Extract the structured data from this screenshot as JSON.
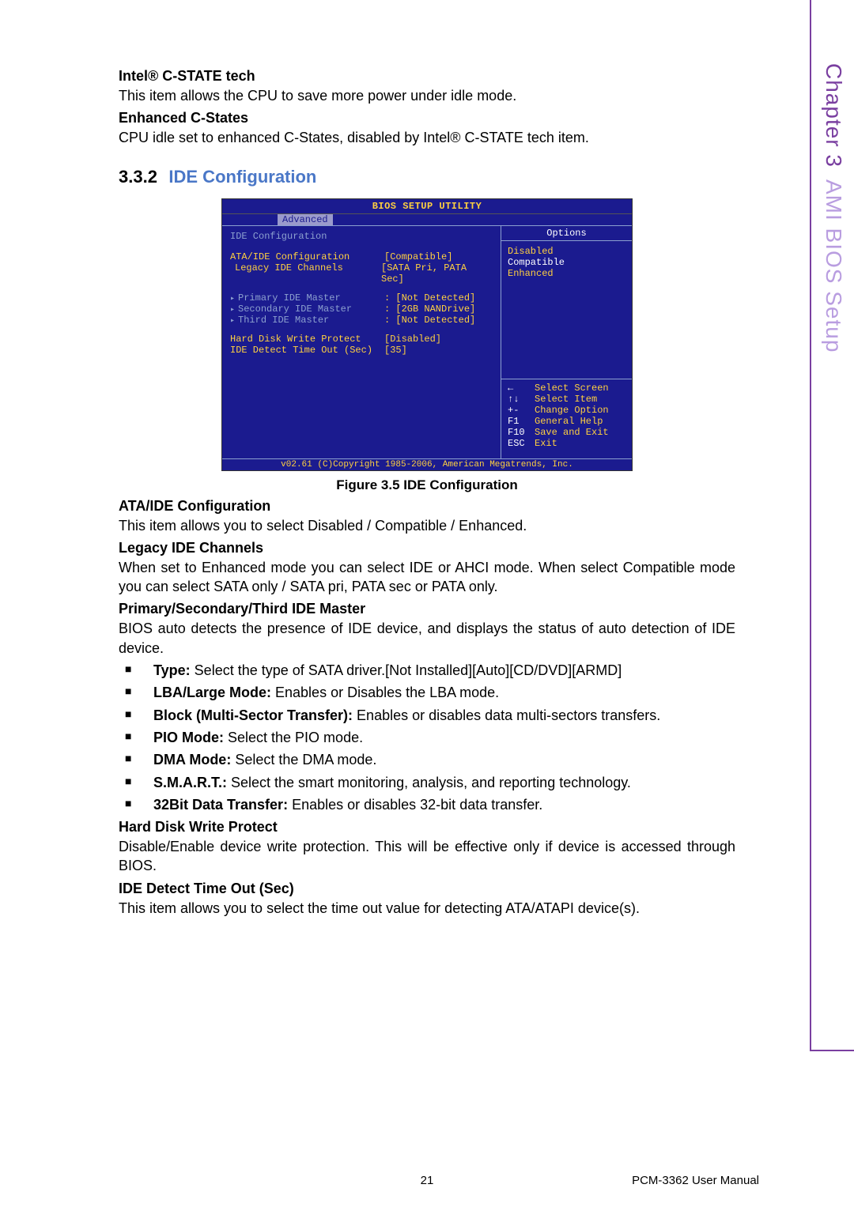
{
  "side": {
    "chapter": "Chapter 3",
    "section": "AMI BIOS Setup"
  },
  "intro": {
    "h1": "Intel® C-STATE tech",
    "p1": "This item allows the CPU to save more power under idle mode.",
    "h2": "Enhanced C-States",
    "p2": "CPU idle set to enhanced C-States, disabled by Intel® C-STATE tech item."
  },
  "section": {
    "num": "3.3.2",
    "title": "IDE Configuration"
  },
  "bios": {
    "title": "BIOS SETUP UTILITY",
    "tab": "Advanced",
    "header": "IDE Configuration",
    "rows": [
      {
        "label": "ATA/IDE Configuration",
        "value": "[Compatible]",
        "opt": true
      },
      {
        "label": "Legacy IDE Channels",
        "value": "[SATA Pri, PATA Sec]",
        "opt": true,
        "indent": true
      }
    ],
    "masters": [
      {
        "label": "Primary IDE Master",
        "value": ": [Not Detected]"
      },
      {
        "label": "Secondary IDE Master",
        "value": ": [2GB NANDrive]"
      },
      {
        "label": "Third IDE Master",
        "value": ": [Not Detected]"
      }
    ],
    "extra": [
      {
        "label": "Hard Disk Write Protect",
        "value": "[Disabled]"
      },
      {
        "label": "IDE Detect Time Out (Sec)",
        "value": "[35]"
      }
    ],
    "options_header": "Options",
    "options": [
      "Disabled",
      "Compatible",
      "Enhanced"
    ],
    "selected_option": "Compatible",
    "nav": [
      {
        "key": "←",
        "text": "Select Screen"
      },
      {
        "key": "↑↓",
        "text": "Select Item"
      },
      {
        "key": "+-",
        "text": "Change Option"
      },
      {
        "key": "F1",
        "text": "General Help"
      },
      {
        "key": "F10",
        "text": "Save and Exit"
      },
      {
        "key": "ESC",
        "text": "Exit"
      }
    ],
    "copyright": "v02.61 (C)Copyright 1985-2006, American Megatrends, Inc."
  },
  "caption": "Figure 3.5 IDE Configuration",
  "below": {
    "h1": "ATA/IDE Configuration",
    "p1": "This item allows you to select Disabled / Compatible / Enhanced.",
    "h2": "Legacy IDE Channels",
    "p2": "When set to Enhanced mode you can select IDE or AHCI mode. When select Compatible mode you can select SATA only / SATA pri, PATA sec or PATA only.",
    "h3": "Primary/Secondary/Third IDE Master",
    "p3": "BIOS auto detects the presence of IDE device, and displays the status of auto detection of IDE device.",
    "bullets": [
      {
        "b": "Type:",
        "t": " Select the type of SATA driver.[Not Installed][Auto][CD/DVD][ARMD]"
      },
      {
        "b": "LBA/Large Mode:",
        "t": " Enables or Disables the LBA mode."
      },
      {
        "b": "Block (Multi-Sector Transfer):",
        "t": " Enables or disables data multi-sectors transfers."
      },
      {
        "b": "PIO Mode:",
        "t": " Select the PIO mode."
      },
      {
        "b": "DMA Mode:",
        "t": " Select the DMA mode."
      },
      {
        "b": "S.M.A.R.T.:",
        "t": " Select the smart monitoring, analysis, and reporting technology."
      },
      {
        "b": "32Bit Data Transfer:",
        "t": " Enables or disables 32-bit data transfer."
      }
    ],
    "h4": "Hard Disk Write Protect",
    "p4": "Disable/Enable device write protection. This will be effective only if device is accessed through BIOS.",
    "h5": "IDE Detect Time Out (Sec)",
    "p5": "This item allows you to select the time out value for detecting ATA/ATAPI device(s)."
  },
  "footer": {
    "page": "21",
    "manual": "PCM-3362 User Manual"
  }
}
